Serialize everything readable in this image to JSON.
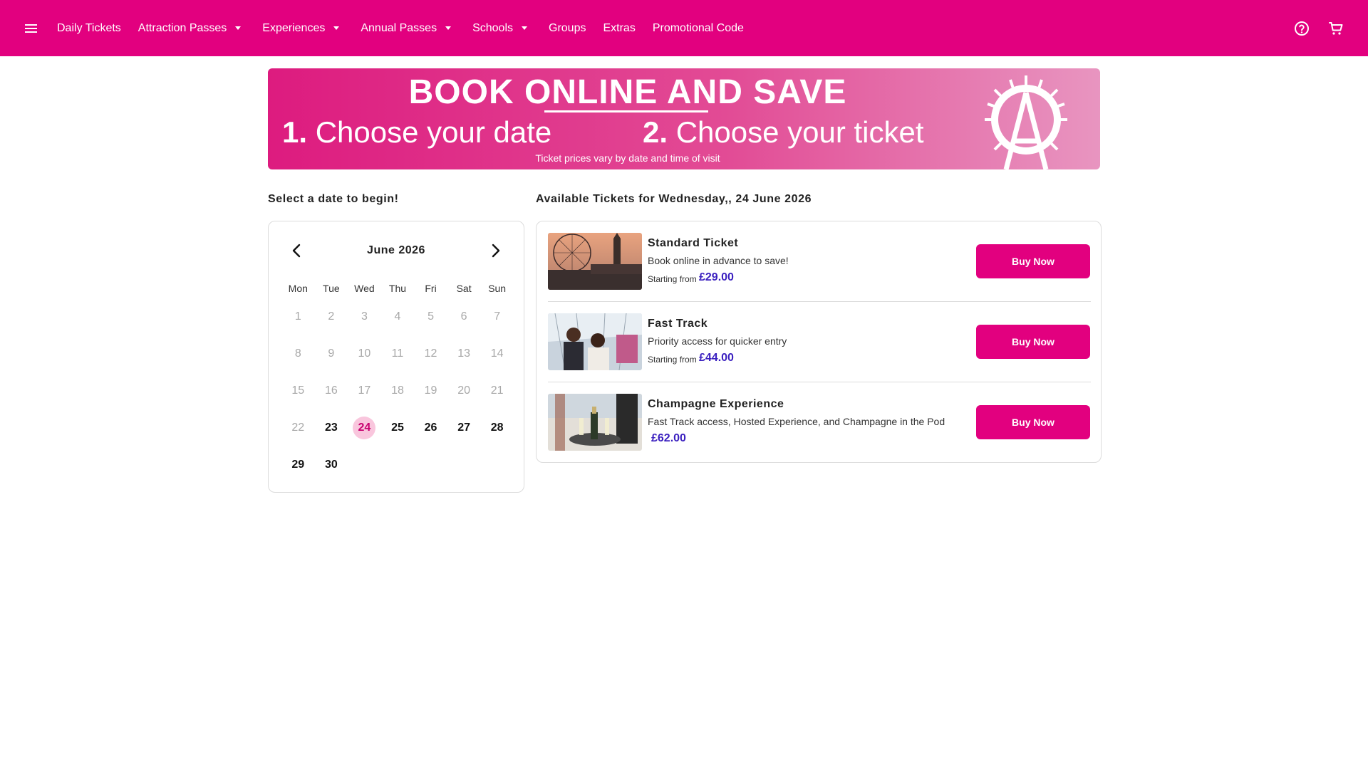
{
  "nav": {
    "links": [
      "Daily Tickets",
      "Attraction Passes",
      "Experiences",
      "Annual Passes",
      "Schools",
      "Groups",
      "Extras",
      "Promotional Code"
    ]
  },
  "banner": {
    "headline": "BOOK ONLINE AND SAVE",
    "step1_num": "1.",
    "step1_text": "Choose your date",
    "step2_num": "2.",
    "step2_text": "Choose your ticket",
    "subtext": "Ticket prices vary by date and time of visit"
  },
  "calendar": {
    "heading": "Select a date to begin!",
    "month": "June 2026",
    "weekdays": [
      "Mon",
      "Tue",
      "Wed",
      "Thu",
      "Fri",
      "Sat",
      "Sun"
    ],
    "selected_day": "24"
  },
  "tickets": {
    "heading": "Available Tickets for Wednesday,, 24 June 2026",
    "items": [
      {
        "name": "Standard Ticket",
        "description": "Book online in advance to save!",
        "from_label": "Starting from",
        "price": "£29.00",
        "button": "Buy Now"
      },
      {
        "name": "Fast Track",
        "description": "Priority access for quicker entry",
        "from_label": "Starting from",
        "price": "£44.00",
        "button": "Buy Now"
      },
      {
        "name": "Champagne Experience",
        "description": "Fast Track access, Hosted Experience, and Champagne in the Pod",
        "from_label": "",
        "price": "£62.00",
        "button": "Buy Now"
      }
    ]
  },
  "colors": {
    "brand": "#e2007f",
    "price": "#3a1fbf",
    "selected_day_bg": "#f9c6dd"
  },
  "icons": {
    "menu": "hamburger-icon",
    "help": "help-circle-icon",
    "cart": "cart-icon"
  }
}
